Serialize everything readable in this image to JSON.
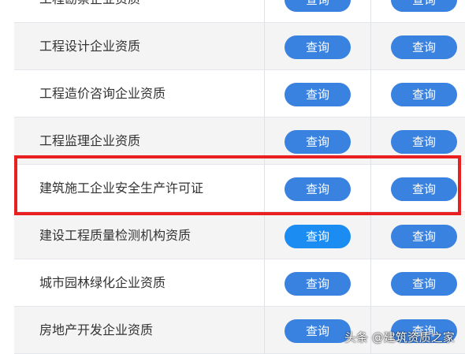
{
  "colors": {
    "button": "#3a82e0",
    "button_active": "#1a8cf2",
    "highlight": "#e8201f"
  },
  "rows": [
    {
      "label": "工程勘察企业资质",
      "btn1": "查询",
      "btn2": "查询"
    },
    {
      "label": "工程设计企业资质",
      "btn1": "查询",
      "btn2": "查询"
    },
    {
      "label": "工程造价咨询企业资质",
      "btn1": "查询",
      "btn2": "查询"
    },
    {
      "label": "工程监理企业资质",
      "btn1": "查询",
      "btn2": "查询"
    },
    {
      "label": "建筑施工企业安全生产许可证",
      "btn1": "查询",
      "btn2": "查询",
      "highlighted": true
    },
    {
      "label": "建设工程质量检测机构资质",
      "btn1": "查询",
      "btn2": "查询",
      "btn1_active": true
    },
    {
      "label": "城市园林绿化企业资质",
      "btn1": "查询",
      "btn2": "查询"
    },
    {
      "label": "房地产开发企业资质",
      "btn1": "查询",
      "btn2": "查询"
    }
  ],
  "watermark": "头条 @建筑资质之家"
}
